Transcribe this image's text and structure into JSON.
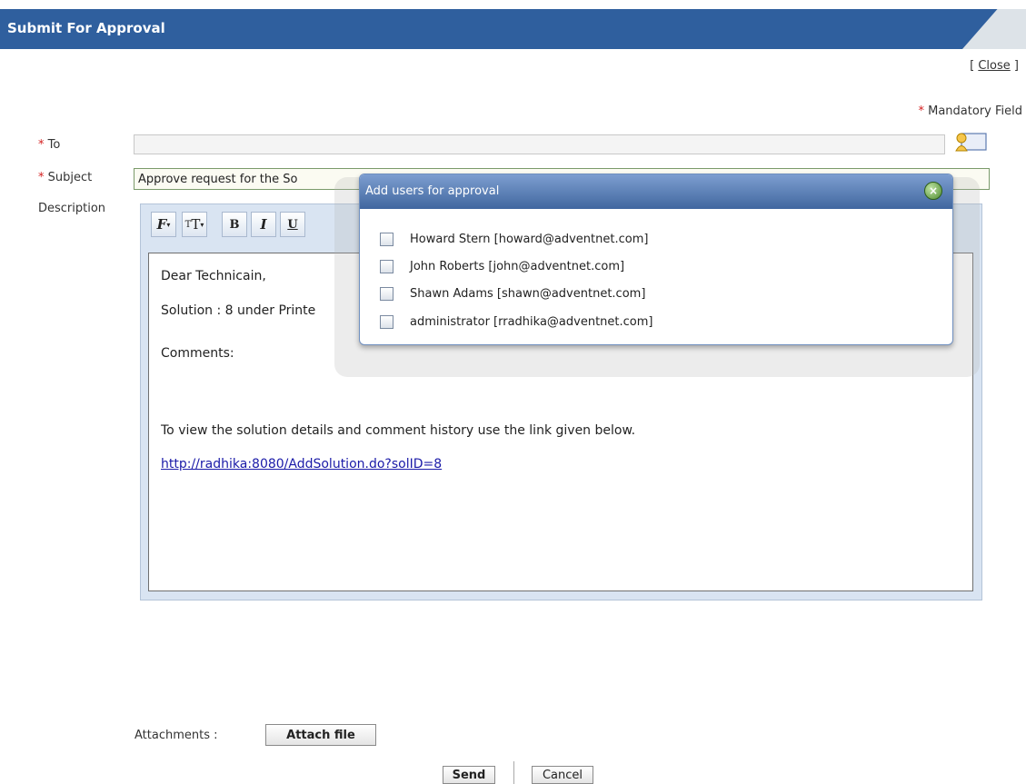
{
  "header": {
    "title": "Submit For Approval"
  },
  "close": {
    "open_bracket": "[",
    "label": "Close",
    "close_bracket": "]"
  },
  "mandatory": {
    "star": "*",
    "text": "Mandatory Field"
  },
  "form": {
    "to_label": "To",
    "to_value": "",
    "subject_label": "Subject",
    "subject_value": "Approve request for the So",
    "description_label": "Description",
    "required_star": "*"
  },
  "toolbar": {
    "buttons": [
      {
        "name": "font-family",
        "glyph": "F"
      },
      {
        "name": "font-size",
        "glyph": "T"
      },
      {
        "name": "bold",
        "glyph": "B"
      },
      {
        "name": "italic",
        "glyph": "I"
      },
      {
        "name": "underline",
        "glyph": "U"
      }
    ]
  },
  "editor": {
    "greeting": "Dear Technicain,",
    "solution": "Solution : 8 under Printe",
    "comments": "Comments:",
    "instructions": "To view the solution details and comment history use the link given below.",
    "link": "http://radhika:8080/AddSolution.do?solID=8"
  },
  "popup": {
    "title": "Add users for approval",
    "close_glyph": "×",
    "users": [
      "Howard Stern [howard@adventnet.com]",
      "John Roberts [john@adventnet.com]",
      "Shawn Adams [shawn@adventnet.com]",
      "administrator [rradhika@adventnet.com]"
    ]
  },
  "attachments": {
    "label": "Attachments :",
    "button": "Attach file"
  },
  "actions": {
    "send": "Send",
    "cancel": "Cancel"
  },
  "colors": {
    "header_bg": "#2f5f9e",
    "required": "#d42020",
    "link": "#1a1aa8"
  }
}
